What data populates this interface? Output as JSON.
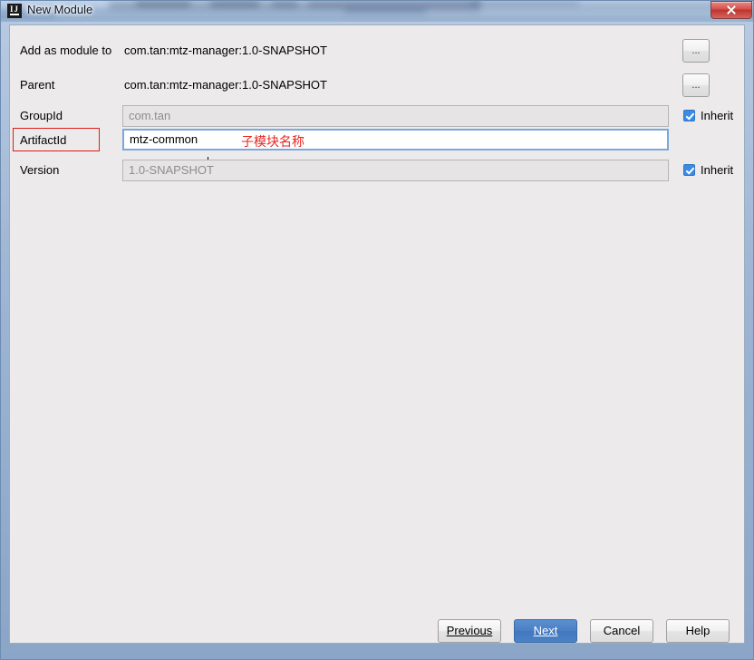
{
  "window": {
    "title": "New Module",
    "icon": "intellij-idea-icon",
    "close_label": "x"
  },
  "form": {
    "rows": [
      {
        "label": "Add as module to",
        "value": "com.tan:mtz-manager:1.0-SNAPSHOT"
      },
      {
        "label": "Parent",
        "value": "com.tan:mtz-manager:1.0-SNAPSHOT"
      }
    ],
    "fields": [
      {
        "label": "GroupId",
        "value": "com.tan",
        "state": "disabled"
      },
      {
        "label": "ArtifactId",
        "value": "mtz-common",
        "state": "focused"
      },
      {
        "label": "Version",
        "value": "1.0-SNAPSHOT",
        "state": "disabled"
      }
    ],
    "browse_buttons": [
      {
        "label": "...",
        "name": "add-as-module-to-browse-button"
      },
      {
        "label": "...",
        "name": "parent-browse-button"
      }
    ],
    "checkboxes": [
      {
        "label": "Inherit",
        "checked": true,
        "name": "groupid-inherit-checkbox"
      },
      {
        "label": "Inherit",
        "checked": true,
        "name": "version-inherit-checkbox"
      }
    ]
  },
  "annotations": {
    "highlight_target": "ArtifactId",
    "note_text": "子模块名称",
    "color": "#e8251f"
  },
  "footer": {
    "buttons": [
      {
        "label": "Previous",
        "mnemonic": "P",
        "primary": false
      },
      {
        "label": "Next",
        "mnemonic": "N",
        "primary": true
      },
      {
        "label": "Cancel",
        "mnemonic": "",
        "primary": false
      },
      {
        "label": "Help",
        "mnemonic": "",
        "primary": false
      }
    ]
  },
  "colors": {
    "accent": "#4a7fc3",
    "annotation": "#e8251f",
    "checkbox": "#3b8ae4",
    "panel": "#eceaea"
  }
}
